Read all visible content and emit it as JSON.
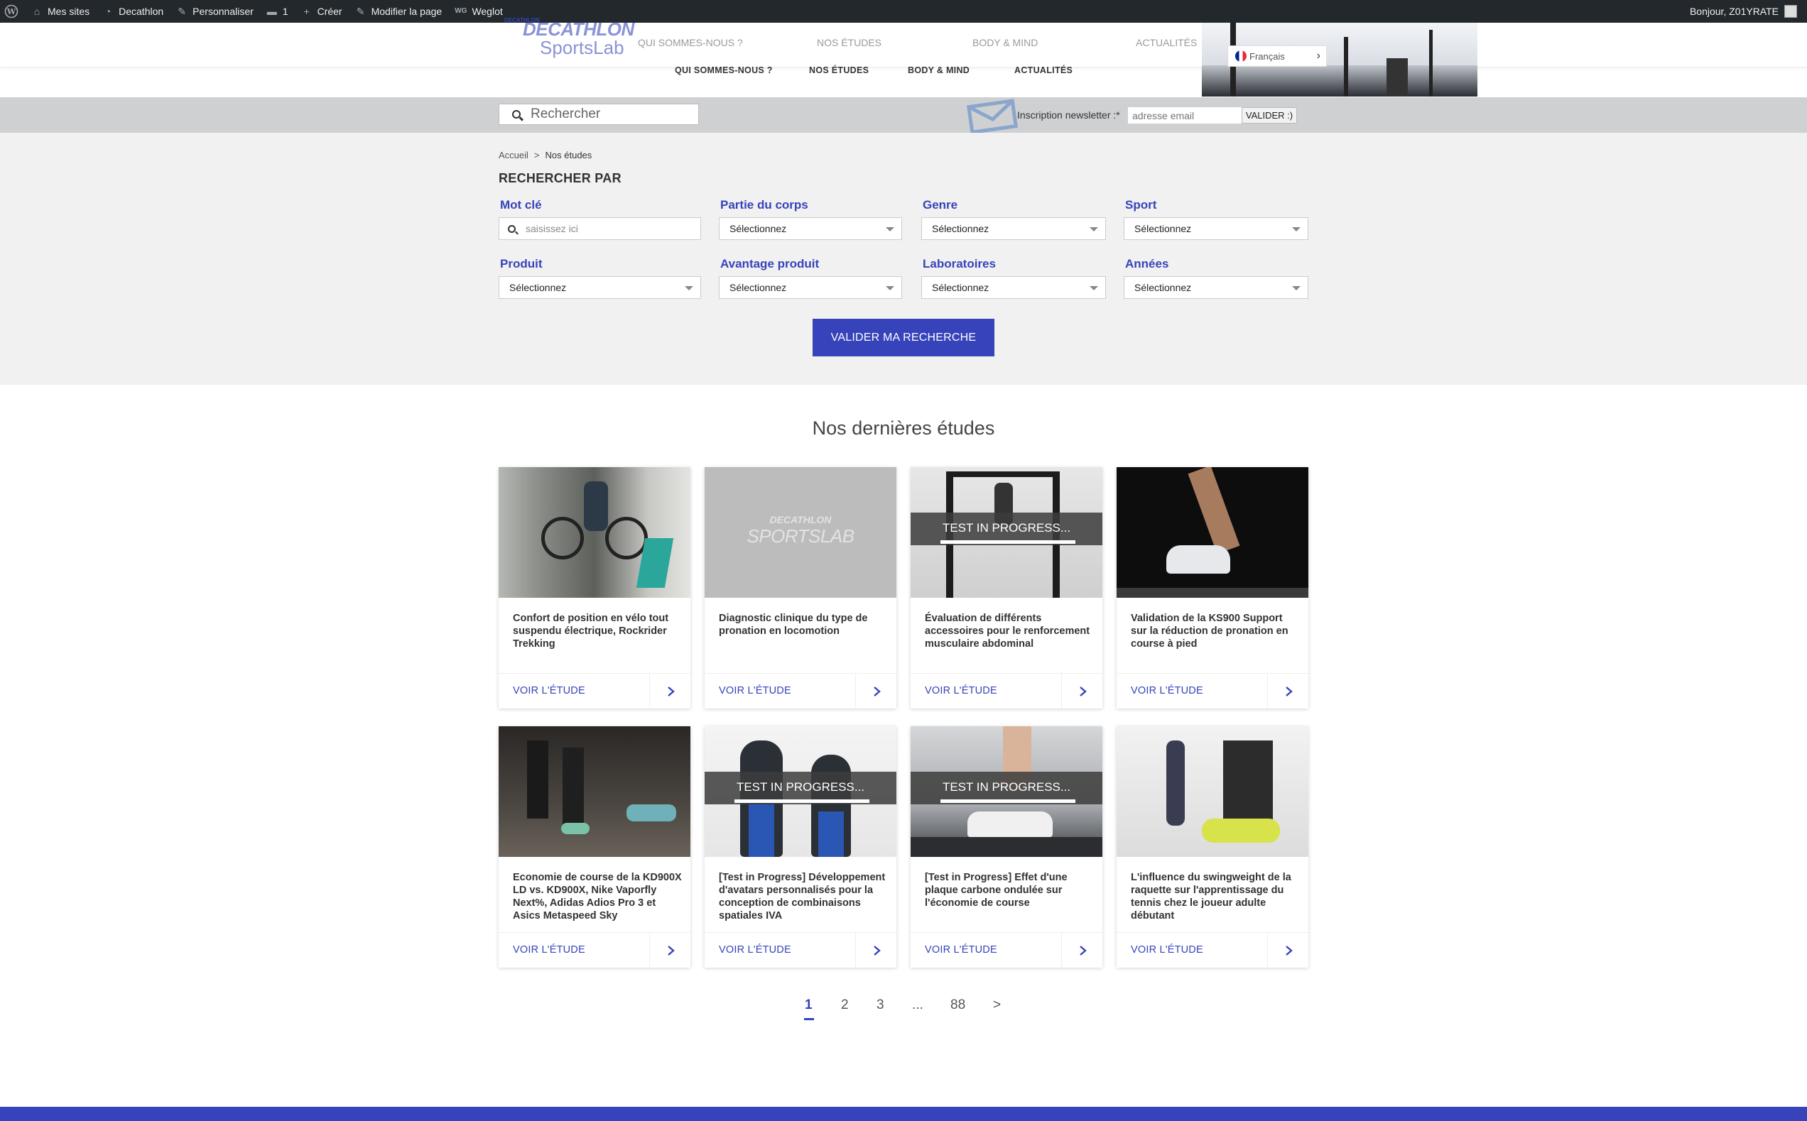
{
  "adminbar": {
    "items": [
      {
        "label": "Mes sites",
        "icon": "home-icon"
      },
      {
        "label": "Decathlon",
        "icon": "dashboard-icon"
      },
      {
        "label": "Personnaliser",
        "icon": "brush-icon"
      },
      {
        "label": "1",
        "icon": "comment-icon"
      },
      {
        "label": "Créer",
        "icon": "plus-icon"
      },
      {
        "label": "Modifier la page",
        "icon": "pencil-icon"
      },
      {
        "label": "Weglot",
        "icon": "weglot-icon"
      }
    ],
    "greeting": "Bonjour, Z01YRATE"
  },
  "header": {
    "logo_small": "DECATHLON",
    "logo_brand": "DECATHLON",
    "logo_sub": "SportsLab",
    "ghost_nav": [
      "QUI SOMMES-NOUS ?",
      "NOS ÉTUDES",
      "BODY & MIND",
      "ACTUALITÉS"
    ],
    "nav": [
      "QUI SOMMES-NOUS ?",
      "NOS ÉTUDES",
      "BODY & MIND",
      "ACTUALITÉS"
    ],
    "language": "Français"
  },
  "search": {
    "placeholder": "Rechercher",
    "newsletter_label": "Inscription newsletter :*",
    "newsletter_placeholder": "adresse email",
    "newsletter_button": "VALIDER :)"
  },
  "panel": {
    "breadcrumb": [
      "Accueil",
      "Nos études"
    ],
    "breadcrumb_sep": ">",
    "title": "RECHERCHER PAR",
    "keyword_label": "Mot clé",
    "keyword_placeholder": "saisissez ici",
    "filters": [
      {
        "label": "Partie du corps",
        "value": "Sélectionnez"
      },
      {
        "label": "Genre",
        "value": "Sélectionnez"
      },
      {
        "label": "Sport",
        "value": "Sélectionnez"
      },
      {
        "label": "Produit",
        "value": "Sélectionnez"
      },
      {
        "label": "Avantage produit",
        "value": "Sélectionnez"
      },
      {
        "label": "Laboratoires",
        "value": "Sélectionnez"
      },
      {
        "label": "Années",
        "value": "Sélectionnez"
      }
    ],
    "submit": "VALIDER MA RECHERCHE"
  },
  "latest": {
    "title": "Nos dernières études",
    "cta": "VOIR L'ÉTUDE",
    "in_progress": "TEST IN PROGRESS...",
    "placeholder_logo": "DECATHLON",
    "placeholder_sub": "SPORTSLAB",
    "cards": [
      {
        "title": "Confort de position en vélo tout suspendu électrique, Rockrider Trekking",
        "in_progress": false
      },
      {
        "title": "Diagnostic clinique du type de pronation en locomotion",
        "in_progress": false
      },
      {
        "title": "Évaluation de différents accessoires pour le renforcement musculaire abdominal",
        "in_progress": true
      },
      {
        "title": "Validation de la KS900 Support sur la réduction de pronation en course à pied",
        "in_progress": false
      },
      {
        "title": "Economie de course de la KD900X LD vs. KD900X, Nike Vaporfly Next%, Adidas Adios Pro 3 et Asics Metaspeed Sky",
        "in_progress": false
      },
      {
        "title": "[Test in Progress] Développement d'avatars personnalisés pour la conception de combinaisons spatiales IVA",
        "in_progress": true
      },
      {
        "title": "[Test in Progress] Effet d'une plaque carbone ondulée sur l'économie de course",
        "in_progress": true
      },
      {
        "title": "L'influence du swingweight de la raquette sur l'apprentissage du tennis chez le joueur adulte débutant",
        "in_progress": false
      }
    ]
  },
  "pagination": {
    "pages": [
      "1",
      "2",
      "3",
      "...",
      "88",
      ">"
    ],
    "current": "1"
  },
  "colors": {
    "accent": "#3643ba",
    "adminbar": "#23282d",
    "panel": "#f1f1f1",
    "searchbar": "#cfd0d2"
  }
}
